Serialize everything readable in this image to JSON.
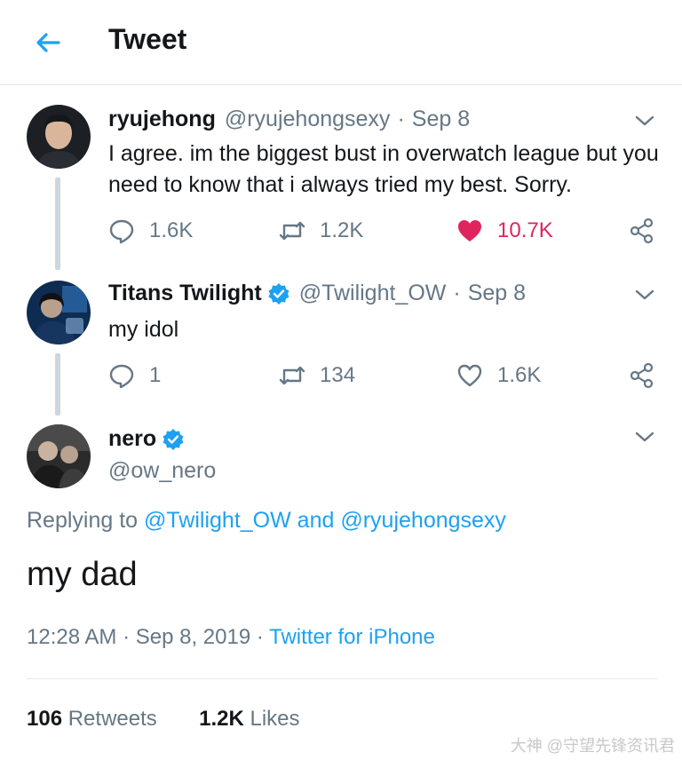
{
  "header": {
    "title": "Tweet",
    "back_icon": "arrow-left-icon",
    "accent": "#1da1f2"
  },
  "tweets": [
    {
      "name": "ryujehong",
      "handle": "@ryujehongsexy",
      "date": "Sep 8",
      "text": "I agree. im the biggest bust in overwatch league but you need to know that i always tried my best. Sorry.",
      "replies": "1.6K",
      "retweets": "1.2K",
      "likes": "10.7K",
      "liked": true,
      "verified": false
    },
    {
      "name": "Titans Twilight",
      "handle": "@Twilight_OW",
      "date": "Sep 8",
      "text": "my idol",
      "replies": "1",
      "retweets": "134",
      "likes": "1.6K",
      "liked": false,
      "verified": true
    }
  ],
  "main": {
    "name": "nero",
    "handle": "@ow_nero",
    "verified": true,
    "replying_prefix": "Replying to",
    "replying_to_1": "@Twilight_OW",
    "replying_and": "and",
    "replying_to_2": "@ryujehongsexy",
    "text": "my dad",
    "time": "12:28 AM",
    "date": "Sep 8, 2019",
    "source": "Twitter for iPhone",
    "retweets_count": "106",
    "retweets_label": "Retweets",
    "likes_count": "1.2K",
    "likes_label": "Likes"
  },
  "watermark": "大神 @守望先锋资讯君",
  "colors": {
    "like": "#e0245e",
    "muted": "#657786",
    "verified": "#1da1f2",
    "line": "#ccd6dd"
  }
}
